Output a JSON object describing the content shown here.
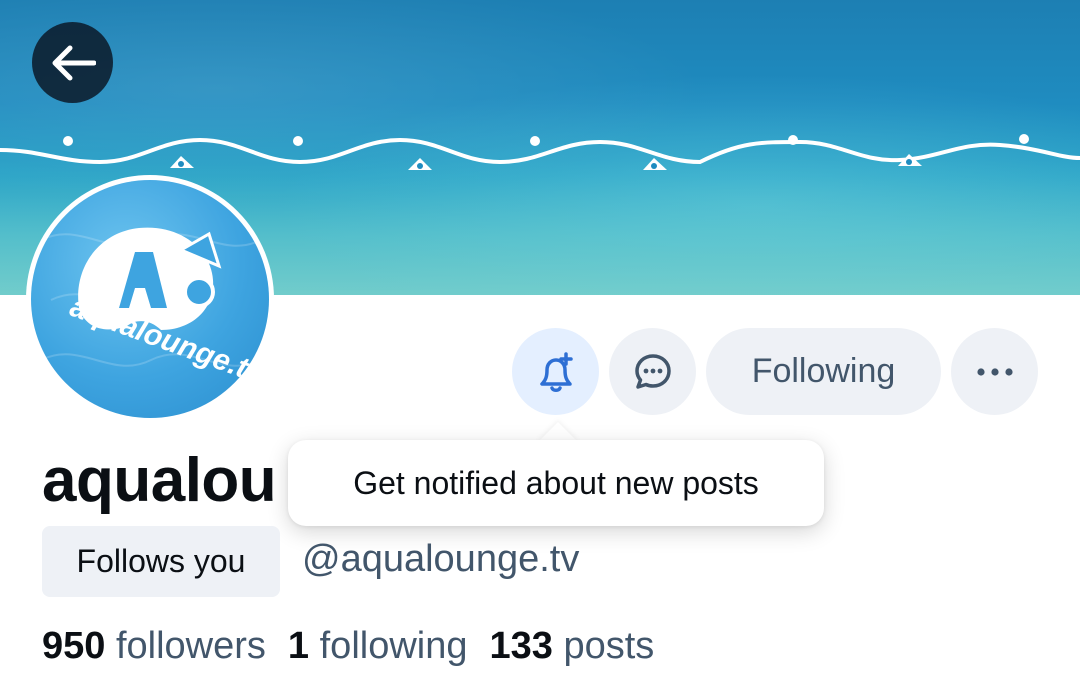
{
  "header": {
    "back_icon": "arrow-left-icon"
  },
  "profile": {
    "avatar_text": "aqualounge.tv",
    "display_name": "aqualou",
    "follows_you_label": "Follows you",
    "handle": "@aqualounge.tv"
  },
  "actions": {
    "notify_icon": "bell-plus-icon",
    "message_icon": "chat-bubble-icon",
    "following_label": "Following",
    "more_icon": "ellipsis-icon"
  },
  "tooltip": {
    "text": "Get notified about new posts"
  },
  "stats": {
    "followers_count": "950",
    "followers_label": "followers",
    "following_count": "1",
    "following_label": "following",
    "posts_count": "133",
    "posts_label": "posts"
  },
  "colors": {
    "accent": "#2e6fd4",
    "notify_bg": "#e4efff",
    "button_bg": "#eef1f6",
    "secondary_text": "#42566b"
  }
}
